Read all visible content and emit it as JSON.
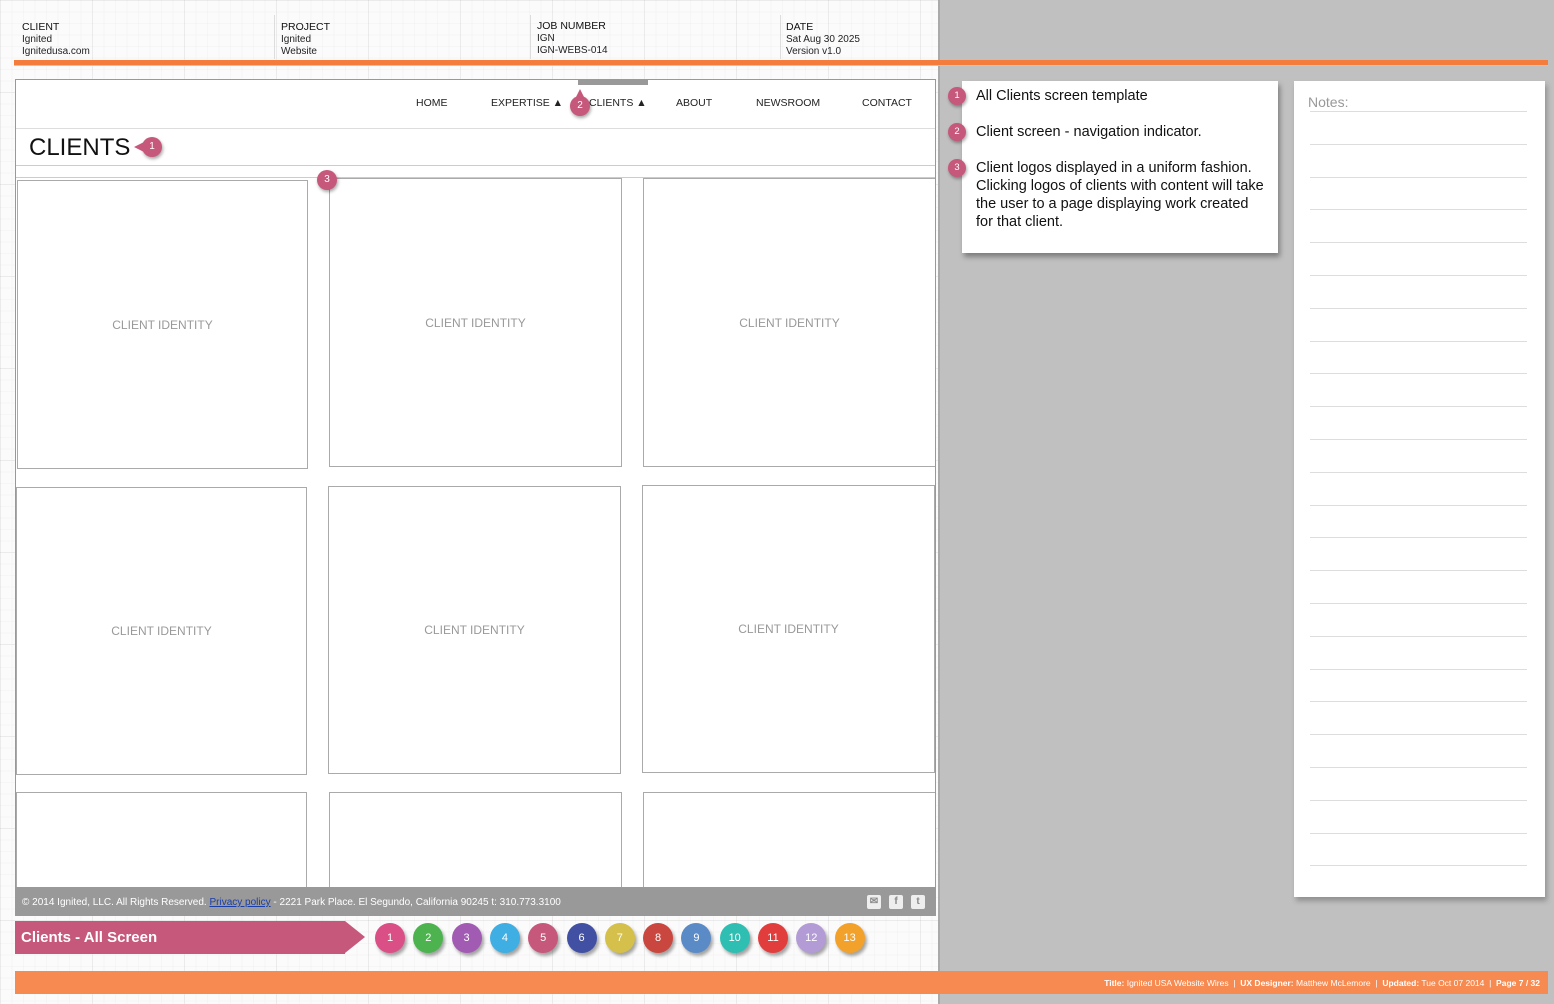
{
  "header": {
    "client": {
      "label": "CLIENT",
      "line1": "Ignited",
      "line2": "Ignitedusa.com"
    },
    "project": {
      "label": "PROJECT",
      "line1": "Ignited",
      "line2": "Website"
    },
    "job": {
      "label": "JOB NUMBER",
      "line1": "IGN",
      "line2": "IGN-WEBS-014"
    },
    "date": {
      "label": "DATE",
      "line1": "Sat Aug 30 2025",
      "line2": "Version v1.0"
    }
  },
  "nav": {
    "home": "HOME",
    "expertise": "EXPERTISE ▲",
    "clients": "CLIENTS ▲",
    "about": "ABOUT",
    "newsroom": "NEWSROOM",
    "contact": "CONTACT"
  },
  "page_title": "CLIENTS",
  "tile_label": "CLIENT IDENTITY",
  "footer": {
    "copyright": "© 2014 Ignited, LLC. All Rights Reserved.",
    "privacy": "Privacy policy",
    "address": " -  2221 Park Place. El Segundo, California 90245 t: 310.773.3100"
  },
  "markers": [
    "1",
    "2",
    "3"
  ],
  "screen_label": "Clients - All Screen",
  "screen_dots": [
    {
      "n": "1",
      "color": "#d94f86"
    },
    {
      "n": "2",
      "color": "#4cb34f"
    },
    {
      "n": "3",
      "color": "#a25bb3"
    },
    {
      "n": "4",
      "color": "#3faee3"
    },
    {
      "n": "5",
      "color": "#c5587b"
    },
    {
      "n": "6",
      "color": "#4150a3"
    },
    {
      "n": "7",
      "color": "#d4c04a"
    },
    {
      "n": "8",
      "color": "#c9473f"
    },
    {
      "n": "9",
      "color": "#5a8bc7"
    },
    {
      "n": "10",
      "color": "#2fbfb2"
    },
    {
      "n": "11",
      "color": "#e23d3d"
    },
    {
      "n": "12",
      "color": "#b39bd6"
    },
    {
      "n": "13",
      "color": "#f2a12b"
    }
  ],
  "annotations": [
    {
      "n": "1",
      "text": "All Clients screen template"
    },
    {
      "n": "2",
      "text": "Client screen - navigation indicator."
    },
    {
      "n": "3",
      "text": "Client logos displayed in a uniform fashion. Clicking logos of clients with content will take the user to a page displaying work created for that client."
    }
  ],
  "notes_title": "Notes:",
  "bottom": {
    "title_label": "Title:",
    "title": "Ignited USA Website Wires",
    "designer_label": "UX Designer:",
    "designer": "Matthew McLemore",
    "updated_label": "Updated:",
    "updated": "Tue Oct 07 2014",
    "page": "Page 7 / 32"
  },
  "colors": {
    "accent": "#f47c3c",
    "marker": "#c5587b"
  }
}
